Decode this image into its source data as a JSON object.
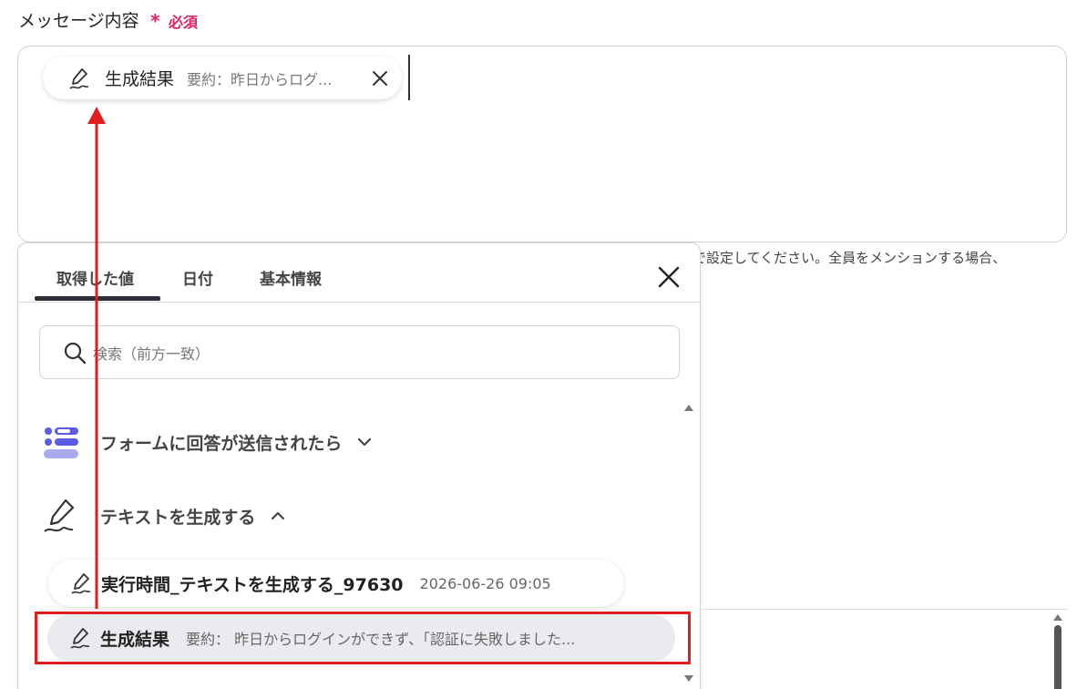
{
  "field": {
    "label": "メッセージ内容",
    "required_star": "*",
    "required_text": "必須"
  },
  "inserted_chip": {
    "name": "生成結果",
    "value": "要約：昨日からログ..."
  },
  "hint_text": "で設定してください。全員をメンションする場合、",
  "panel": {
    "tabs": [
      {
        "label": "取得した値",
        "active": true
      },
      {
        "label": "日付",
        "active": false
      },
      {
        "label": "基本情報",
        "active": false
      }
    ],
    "search_placeholder": "検索（前方一致）",
    "sections": [
      {
        "title": "フォームに回答が送信されたら",
        "expanded": false
      },
      {
        "title": "テキストを生成する",
        "expanded": true
      }
    ],
    "items": [
      {
        "name": "実行時間_テキストを生成する_97630",
        "value": "2026-06-26 09:05"
      },
      {
        "name": "生成結果",
        "value": "要約： 昨日からログインができず、「認証に失敗しました..."
      }
    ]
  },
  "colors": {
    "required": "#e0245e",
    "highlight": "#e01e1e",
    "accent_icon": "#5b5ce6"
  }
}
